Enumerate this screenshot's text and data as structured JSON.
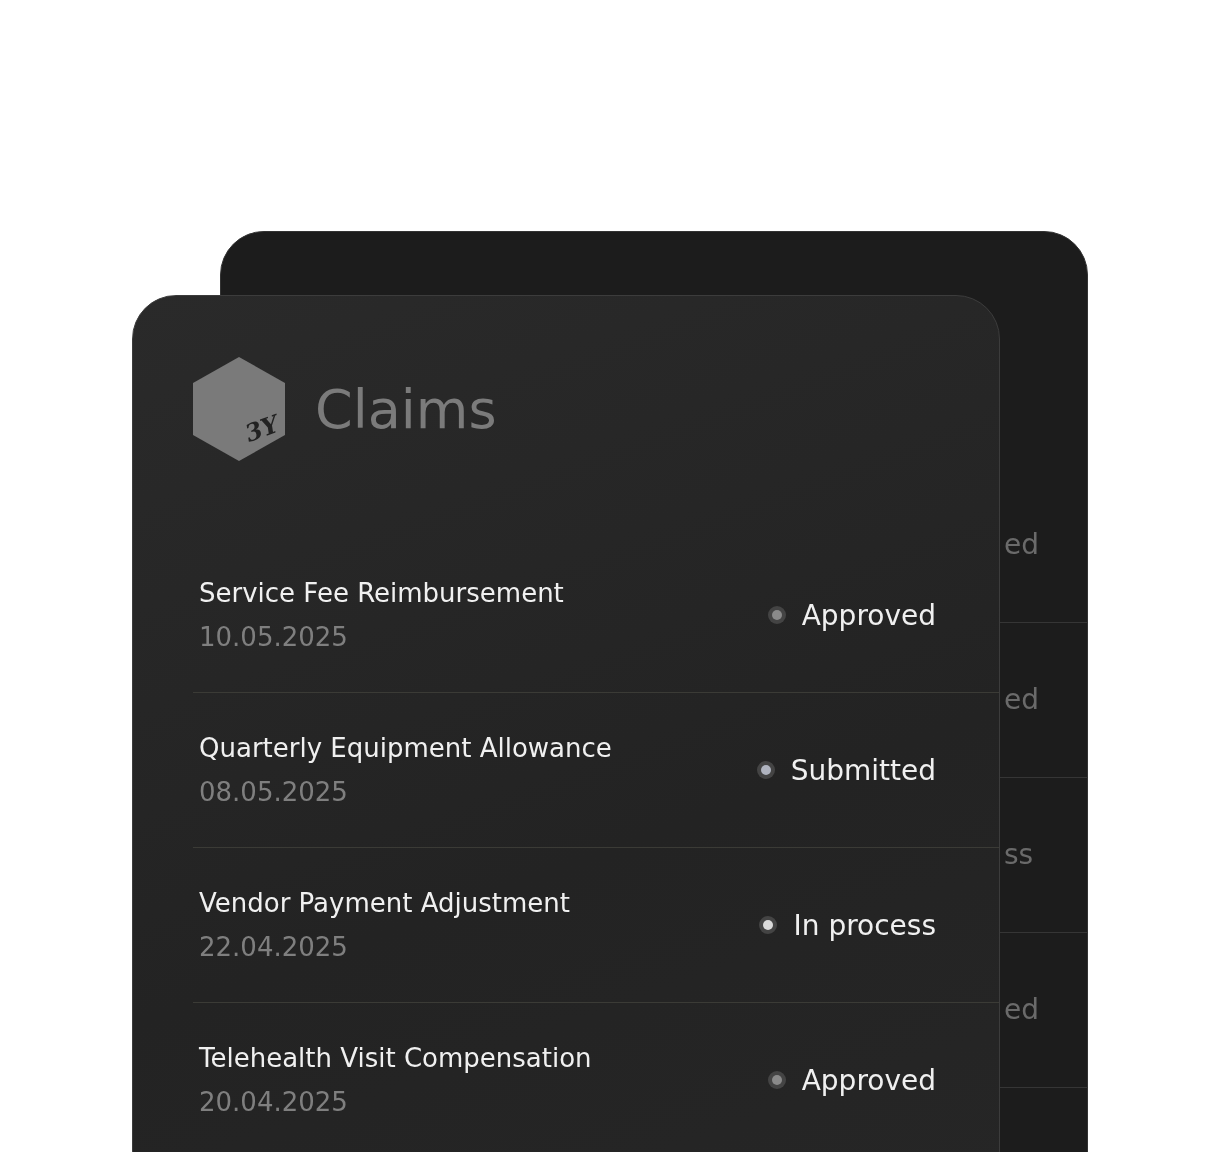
{
  "back_card": {
    "rows": [
      {
        "status": "ed"
      },
      {
        "status": "ed"
      },
      {
        "status": "ss"
      },
      {
        "status": "ed"
      }
    ]
  },
  "header": {
    "logo_text": "3Y",
    "title": "Claims"
  },
  "claims": [
    {
      "title": "Service Fee Reimbursement",
      "date": "10.05.2025",
      "status": "Approved",
      "color": "#8a8a8a"
    },
    {
      "title": "Quarterly Equipment Allowance",
      "date": "08.05.2025",
      "status": "Submitted",
      "color": "#b0b4c0"
    },
    {
      "title": "Vendor Payment Adjustment",
      "date": "22.04.2025",
      "status": "In process",
      "color": "#dadada"
    },
    {
      "title": "Telehealth Visit Compensation",
      "date": "20.04.2025",
      "status": "Approved",
      "color": "#8a8a8a"
    }
  ]
}
